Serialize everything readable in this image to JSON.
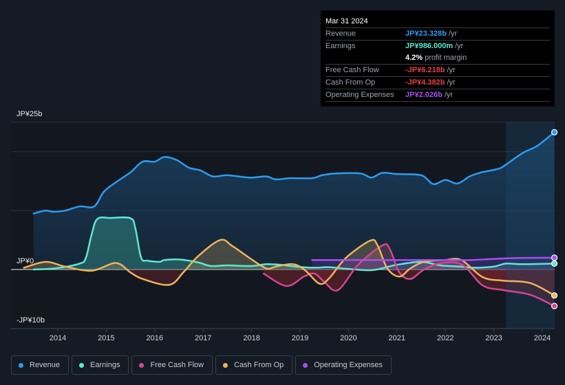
{
  "tooltip": {
    "date": "Mar 31 2024",
    "rows": [
      {
        "label": "Revenue",
        "value": "JP¥23.328b",
        "unit": "/yr",
        "color": "#2d9cf0"
      },
      {
        "label": "Earnings",
        "value": "JP¥986.000m",
        "unit": "/yr",
        "color": "#5ee8d0"
      },
      {
        "label": "",
        "value": "4.2%",
        "unit": "profit margin",
        "color": "#ffffff"
      },
      {
        "label": "Free Cash Flow",
        "value": "-JP¥6.218b",
        "unit": "/yr",
        "color": "#e8404a"
      },
      {
        "label": "Cash From Op",
        "value": "-JP¥4.382b",
        "unit": "/yr",
        "color": "#e8404a"
      },
      {
        "label": "Operating Expenses",
        "value": "JP¥2.026b",
        "unit": "/yr",
        "color": "#a64ff0"
      }
    ]
  },
  "legend": [
    {
      "label": "Revenue",
      "color": "#2d9cf0"
    },
    {
      "label": "Earnings",
      "color": "#5ee8d0"
    },
    {
      "label": "Free Cash Flow",
      "color": "#d6458f"
    },
    {
      "label": "Cash From Op",
      "color": "#f0b35a"
    },
    {
      "label": "Operating Expenses",
      "color": "#a64ff0"
    }
  ],
  "chart_data": {
    "type": "line",
    "title": "",
    "xlabel": "",
    "ylabel": "",
    "y_tick_labels": [
      {
        "value": 25,
        "label": "JP¥25b"
      },
      {
        "value": 0,
        "label": "JP¥0"
      },
      {
        "value": -10,
        "label": "-JP¥10b"
      }
    ],
    "ylim": [
      -10,
      25
    ],
    "xlim": [
      2013.5,
      2024.25
    ],
    "x_ticks": [
      "2014",
      "2015",
      "2016",
      "2017",
      "2018",
      "2019",
      "2020",
      "2021",
      "2022",
      "2023",
      "2024"
    ],
    "highlight_from": 2023.25,
    "grid": true,
    "legend_position": "bottom-left",
    "series": [
      {
        "name": "Revenue",
        "color": "#2d9cf0",
        "points": [
          [
            2013.5,
            9.5
          ],
          [
            2013.75,
            10.0
          ],
          [
            2013.9,
            9.8
          ],
          [
            2014.15,
            10.0
          ],
          [
            2014.45,
            10.7
          ],
          [
            2014.75,
            10.7
          ],
          [
            2014.95,
            13.2
          ],
          [
            2015.2,
            14.8
          ],
          [
            2015.5,
            16.5
          ],
          [
            2015.75,
            18.3
          ],
          [
            2016.0,
            18.3
          ],
          [
            2016.2,
            19.1
          ],
          [
            2016.45,
            18.6
          ],
          [
            2016.7,
            17.3
          ],
          [
            2016.95,
            16.8
          ],
          [
            2017.2,
            15.8
          ],
          [
            2017.5,
            16.0
          ],
          [
            2017.95,
            15.6
          ],
          [
            2018.3,
            15.8
          ],
          [
            2018.5,
            15.3
          ],
          [
            2018.8,
            15.5
          ],
          [
            2019.25,
            15.5
          ],
          [
            2019.45,
            16.0
          ],
          [
            2019.75,
            16.3
          ],
          [
            2020.25,
            16.3
          ],
          [
            2020.47,
            15.6
          ],
          [
            2020.7,
            16.4
          ],
          [
            2021.0,
            16.2
          ],
          [
            2021.5,
            16.0
          ],
          [
            2021.75,
            14.5
          ],
          [
            2022.0,
            15.2
          ],
          [
            2022.25,
            14.6
          ],
          [
            2022.5,
            15.8
          ],
          [
            2022.75,
            16.5
          ],
          [
            2023.1,
            17.1
          ],
          [
            2023.25,
            17.8
          ],
          [
            2023.6,
            19.8
          ],
          [
            2023.9,
            21.0
          ],
          [
            2024.25,
            23.3
          ]
        ]
      },
      {
        "name": "Earnings",
        "color": "#5ee8d0",
        "points": [
          [
            2013.5,
            0
          ],
          [
            2013.95,
            0.2
          ],
          [
            2014.45,
            1.0
          ],
          [
            2014.58,
            2.0
          ],
          [
            2014.7,
            6.0
          ],
          [
            2014.82,
            8.6
          ],
          [
            2015.1,
            8.75
          ],
          [
            2015.5,
            8.7
          ],
          [
            2015.6,
            7.0
          ],
          [
            2015.72,
            2.0
          ],
          [
            2015.85,
            1.5
          ],
          [
            2016.1,
            1.3
          ],
          [
            2016.2,
            1.6
          ],
          [
            2016.5,
            1.7
          ],
          [
            2016.9,
            1.2
          ],
          [
            2017.15,
            0.6
          ],
          [
            2017.5,
            0.7
          ],
          [
            2018.0,
            0.6
          ],
          [
            2018.3,
            0.9
          ],
          [
            2018.6,
            0.8
          ],
          [
            2018.9,
            0.5
          ],
          [
            2019.3,
            0.3
          ],
          [
            2019.6,
            0.4
          ],
          [
            2020.0,
            0.1
          ],
          [
            2020.5,
            -0.1
          ],
          [
            2021.0,
            0.8
          ],
          [
            2021.5,
            1.3
          ],
          [
            2021.9,
            0.7
          ],
          [
            2022.3,
            0.5
          ],
          [
            2022.6,
            0.3
          ],
          [
            2023.0,
            0.5
          ],
          [
            2023.25,
            1.0
          ],
          [
            2023.6,
            0.9
          ],
          [
            2024.25,
            1.0
          ]
        ]
      },
      {
        "name": "Free Cash Flow",
        "color": "#d6458f",
        "points": [
          [
            2018.25,
            -0.7
          ],
          [
            2018.72,
            -2.8
          ],
          [
            2019.08,
            -1.2
          ],
          [
            2019.3,
            -0.7
          ],
          [
            2019.5,
            -2.1
          ],
          [
            2019.78,
            -3.5
          ],
          [
            2020.2,
            0.8
          ],
          [
            2020.7,
            4.1
          ],
          [
            2020.85,
            3.5
          ],
          [
            2021.05,
            -0.5
          ],
          [
            2021.28,
            -1.6
          ],
          [
            2021.56,
            0
          ],
          [
            2021.92,
            1.1
          ],
          [
            2022.35,
            0.8
          ],
          [
            2022.77,
            -2.7
          ],
          [
            2023.2,
            -3.5
          ],
          [
            2023.75,
            -4.3
          ],
          [
            2024.25,
            -6.2
          ]
        ]
      },
      {
        "name": "Cash From Op",
        "color": "#f0b35a",
        "points": [
          [
            2013.3,
            0.3
          ],
          [
            2013.75,
            1.3
          ],
          [
            2014.15,
            0.5
          ],
          [
            2014.7,
            -0.2
          ],
          [
            2015.2,
            1.1
          ],
          [
            2015.5,
            -0.5
          ],
          [
            2015.75,
            -1.6
          ],
          [
            2016.3,
            -2.6
          ],
          [
            2016.6,
            -0.4
          ],
          [
            2016.9,
            2.3
          ],
          [
            2017.35,
            5.0
          ],
          [
            2017.6,
            4.0
          ],
          [
            2017.95,
            2.0
          ],
          [
            2018.3,
            0.2
          ],
          [
            2018.5,
            0.5
          ],
          [
            2018.85,
            0.9
          ],
          [
            2019.1,
            -0.1
          ],
          [
            2019.4,
            -2.4
          ],
          [
            2019.6,
            -1.5
          ],
          [
            2019.95,
            2.0
          ],
          [
            2020.45,
            4.9
          ],
          [
            2020.6,
            4.1
          ],
          [
            2020.8,
            0.2
          ],
          [
            2021.05,
            -1.2
          ],
          [
            2021.28,
            0.2
          ],
          [
            2021.56,
            1.3
          ],
          [
            2021.99,
            1.6
          ],
          [
            2022.33,
            1.6
          ],
          [
            2022.77,
            -1.3
          ],
          [
            2023.2,
            -1.9
          ],
          [
            2023.75,
            -2.3
          ],
          [
            2024.25,
            -4.4
          ]
        ]
      },
      {
        "name": "Operating Expenses",
        "color": "#a64ff0",
        "points": [
          [
            2019.25,
            1.6
          ],
          [
            2020.0,
            1.6
          ],
          [
            2021.0,
            1.6
          ],
          [
            2022.0,
            1.6
          ],
          [
            2022.5,
            1.6
          ],
          [
            2023.0,
            1.8
          ],
          [
            2023.5,
            1.95
          ],
          [
            2024.25,
            2.0
          ]
        ]
      }
    ]
  }
}
